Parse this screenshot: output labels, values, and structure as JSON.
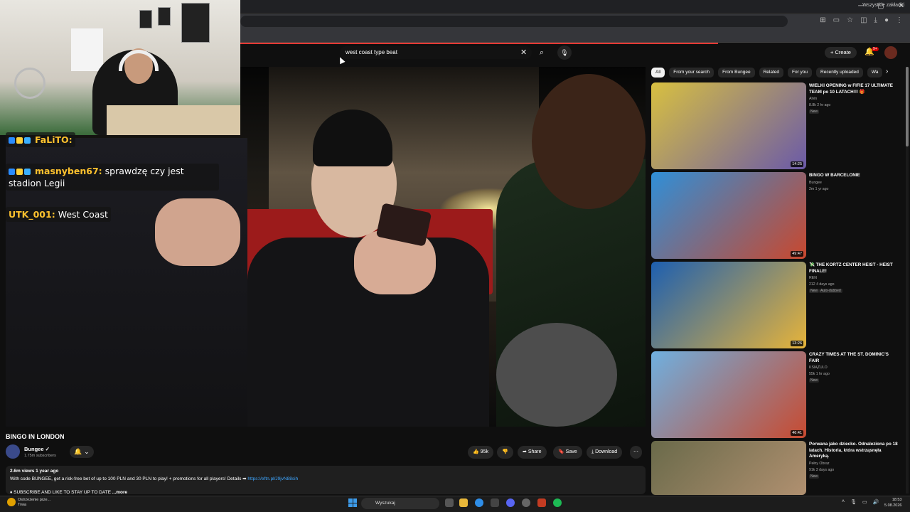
{
  "browser": {
    "bookmarks_all": "Wszystkie zakładki"
  },
  "header": {
    "search_query": "west coast type beat",
    "create_label": "Create",
    "notifications_badge": "9+"
  },
  "chat": [
    {
      "badges": [
        "#2a8cff",
        "#ffd23a",
        "#3bb0ff"
      ],
      "user": "FaLiTO",
      "text": ""
    },
    {
      "badges": [
        "#2a8cff",
        "#ffd23a",
        "#3bb0ff"
      ],
      "user": "masnyben67",
      "text": "sprawdzę czy jest stadion Legii"
    },
    {
      "badges": [],
      "user": "UTK_001",
      "text": "West Coast"
    }
  ],
  "video": {
    "title": "BINGO IN LONDON",
    "channel": "Bungee",
    "subscribers": "1.75m subscribers",
    "likes": "95k",
    "share_label": "Share",
    "save_label": "Save",
    "download_label": "Download",
    "views_date": "2.6m views  1 year ago",
    "description_line1": "With code BUNGEE, get a risk-free bet of up to 100 PLN and 30 PLN to play! + promotions for all players! Details ➡",
    "description_link": "https://eftn.pl/J9jvN88sih",
    "description_line2": "♦ SUBSCRIBE AND LIKE TO STAY UP TO DATE",
    "more_label": "...more"
  },
  "chips": [
    "All",
    "From your search",
    "From Bungee",
    "Related",
    "For you",
    "Recently uploaded",
    "Wa"
  ],
  "related": [
    {
      "title": "WIELKI OPENING w FIFIE 17 ULTIMATE TEAM po 10 LATACH!!! 🎁",
      "channel": "Alvin",
      "meta": "8.8k  2 hr ago",
      "tag": "New",
      "duration": "14:25",
      "thumb_a": "#d8c040",
      "thumb_b": "#6b5aa8"
    },
    {
      "title": "BINGO W BARCELONIE",
      "channel": "Bungee",
      "meta": "2m  1 yr ago",
      "tag": "",
      "duration": "49:47",
      "thumb_a": "#2f8fd8",
      "thumb_b": "#c9482e"
    },
    {
      "title": "💸 THE KORTZ CENTER HEIST - HEIST FINALE!",
      "channel": "REN",
      "meta": "212  4 days ago",
      "tag": "New",
      "tag2": "Auto-dubbed",
      "duration": "13:26",
      "thumb_a": "#1d5fb0",
      "thumb_b": "#e7b43a"
    },
    {
      "title": "CRAZY TIMES AT THE ST. DOMINIC'S FAIR",
      "channel": "KSIĄŻULO",
      "meta": "55k  1 hr ago",
      "tag": "New",
      "duration": "46:41",
      "thumb_a": "#6fb0e0",
      "thumb_b": "#c84a30"
    },
    {
      "title": "Porwana jako dziecko. Odnaleziona po 18 latach. Historia, która wstrząsnęła Ameryką.",
      "channel": "Pełny Obraz",
      "meta": "91k  3 days ago",
      "tag": "New",
      "duration": "",
      "thumb_a": "#6a6a4a",
      "thumb_b": "#b09070"
    }
  ],
  "taskbar": {
    "weather_title": "Ostrzeżenie prze...",
    "weather_sub": "Trwa",
    "search_label": "Wyszukaj",
    "time": "18:53",
    "date": "5.08.2026"
  }
}
